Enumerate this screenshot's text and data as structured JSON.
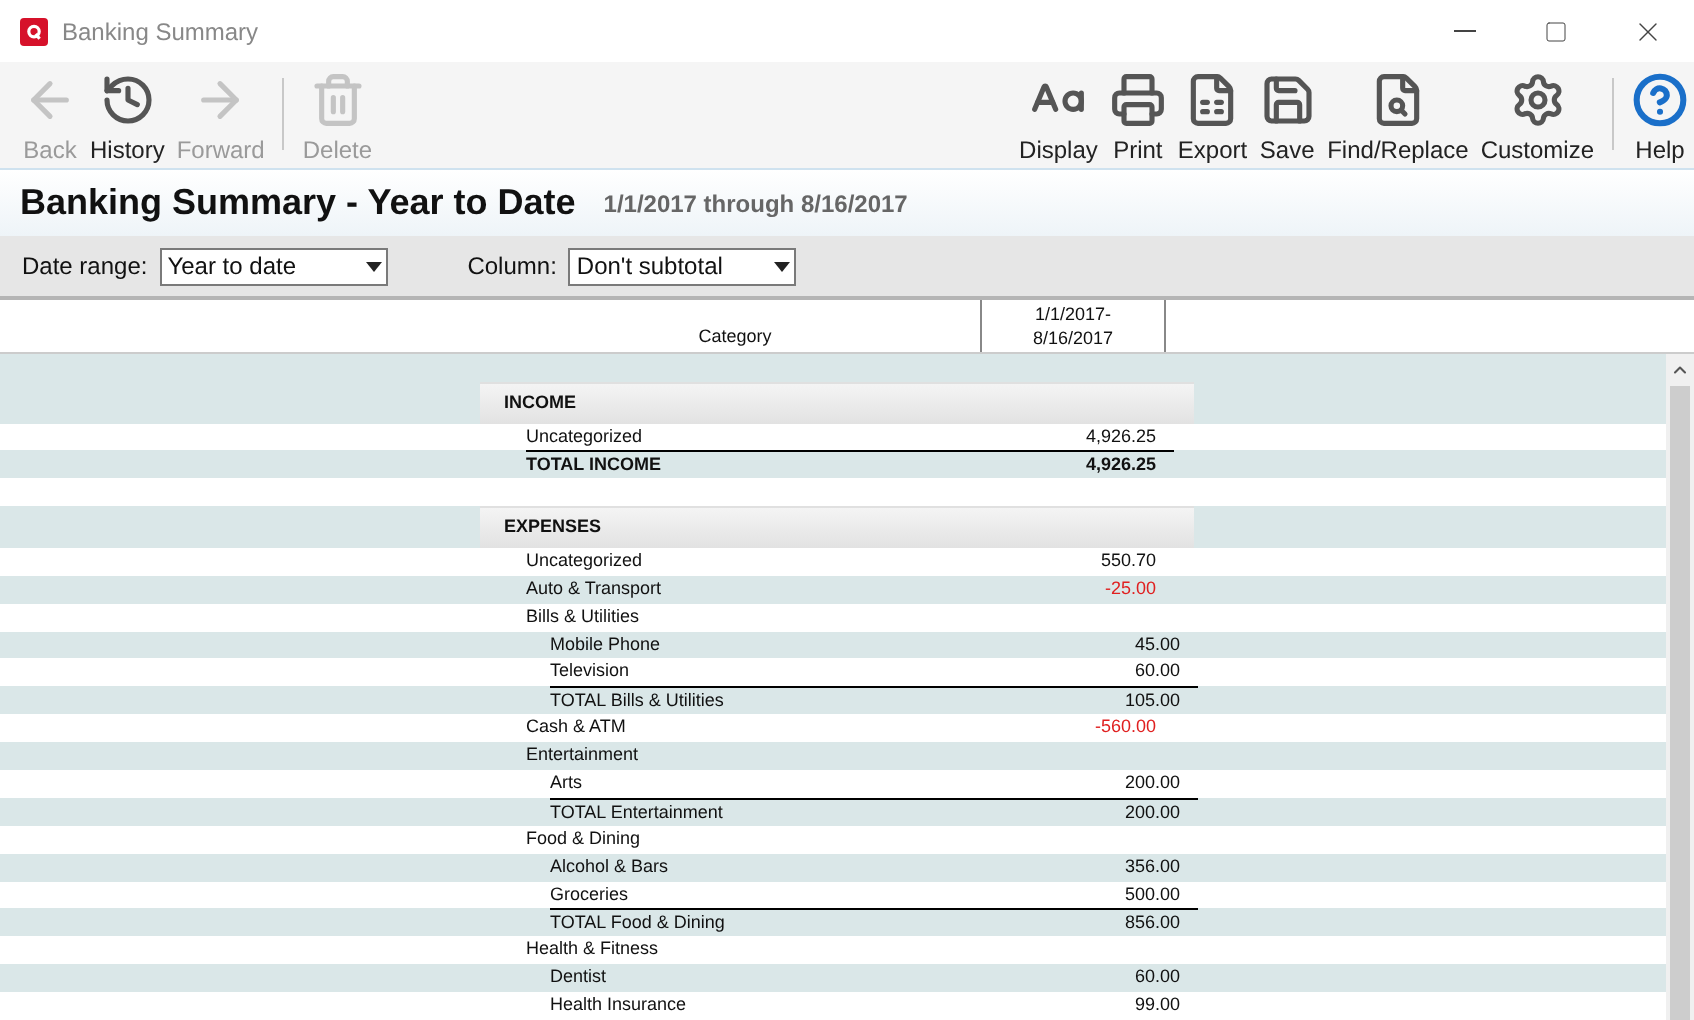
{
  "window": {
    "title": "Banking Summary"
  },
  "toolbar": {
    "left": [
      {
        "kind": "back",
        "label": "Back",
        "disabled": true
      },
      {
        "kind": "history",
        "label": "History",
        "disabled": false
      },
      {
        "kind": "forward",
        "label": "Forward",
        "disabled": true
      },
      {
        "kind": "separator"
      },
      {
        "kind": "delete",
        "label": "Delete",
        "disabled": true
      }
    ],
    "right": [
      {
        "kind": "display",
        "label": "Display",
        "disabled": false
      },
      {
        "kind": "print",
        "label": "Print",
        "disabled": false
      },
      {
        "kind": "export",
        "label": "Export",
        "disabled": false
      },
      {
        "kind": "save",
        "label": "Save",
        "disabled": false
      },
      {
        "kind": "find",
        "label": "Find/Replace",
        "disabled": false
      },
      {
        "kind": "customize",
        "label": "Customize",
        "disabled": false
      },
      {
        "kind": "separator"
      },
      {
        "kind": "help",
        "label": "Help",
        "disabled": false
      }
    ]
  },
  "report": {
    "title": "Banking Summary - Year to Date",
    "date_span": "1/1/2017 through 8/16/2017"
  },
  "filters": [
    {
      "label": "Date range:",
      "value": "Year to date"
    },
    {
      "label": "Column:",
      "value": "Don't subtotal"
    }
  ],
  "table": {
    "columns": [
      "Category",
      "1/1/2017-8/16/2017"
    ],
    "sections": [
      {
        "title": "INCOME",
        "rows": [
          {
            "label": "Uncategorized",
            "amount": "4,926.25",
            "negative": false
          }
        ],
        "total": {
          "label": "TOTAL INCOME",
          "amount": "4,926.25"
        }
      },
      {
        "title": "EXPENSES",
        "rows": [
          {
            "label": "Uncategorized",
            "amount": "550.70",
            "negative": false
          },
          {
            "label": "Auto & Transport",
            "amount": "-25.00",
            "negative": true
          },
          {
            "label": "Bills & Utilities",
            "children": [
              {
                "label": "Mobile Phone",
                "amount": "45.00",
                "negative": false
              },
              {
                "label": "Television",
                "amount": "60.00",
                "negative": false
              }
            ],
            "total": {
              "label": "TOTAL Bills & Utilities",
              "amount": "105.00"
            }
          },
          {
            "label": "Cash & ATM",
            "amount": "-560.00",
            "negative": true
          },
          {
            "label": "Entertainment",
            "children": [
              {
                "label": "Arts",
                "amount": "200.00",
                "negative": false
              }
            ],
            "total": {
              "label": "TOTAL Entertainment",
              "amount": "200.00"
            }
          },
          {
            "label": "Food & Dining",
            "children": [
              {
                "label": "Alcohol & Bars",
                "amount": "356.00",
                "negative": false
              },
              {
                "label": "Groceries",
                "amount": "500.00",
                "negative": false
              }
            ],
            "total": {
              "label": "TOTAL Food & Dining",
              "amount": "856.00"
            }
          },
          {
            "label": "Health & Fitness",
            "children": [
              {
                "label": "Dentist",
                "amount": "60.00",
                "negative": false
              },
              {
                "label": "Health Insurance",
                "amount": "99.00",
                "negative": false
              }
            ]
          }
        ]
      }
    ]
  }
}
